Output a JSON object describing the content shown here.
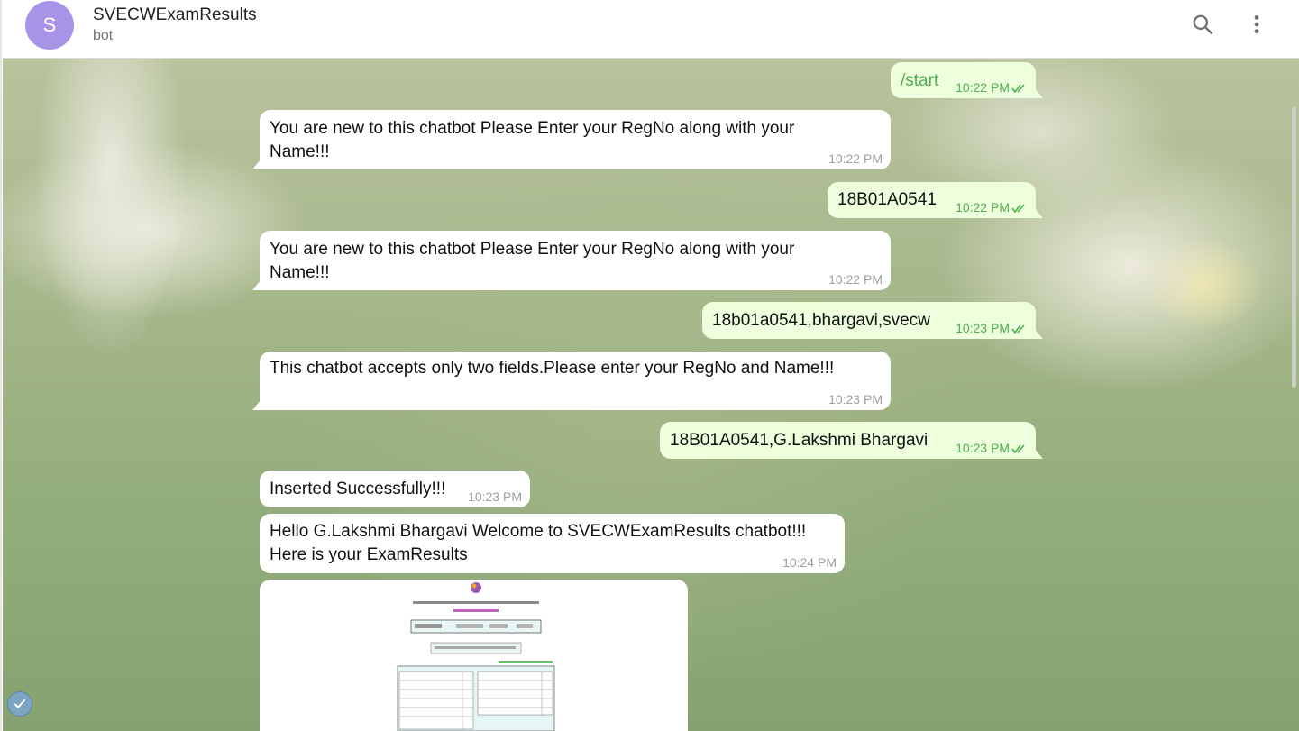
{
  "header": {
    "avatar_letter": "S",
    "title": "SVECWExamResults",
    "subtitle": "bot",
    "avatar_color": "#a695e7"
  },
  "messages": [
    {
      "from": "user",
      "text": "/start",
      "time": "10:22 PM"
    },
    {
      "from": "bot",
      "text": "You are new to this chatbot Please Enter your RegNo along with your Name!!!",
      "time": "10:22 PM"
    },
    {
      "from": "user",
      "text": "18B01A0541",
      "time": "10:22 PM"
    },
    {
      "from": "bot",
      "text": "You are new to this chatbot Please Enter your RegNo along with your Name!!!",
      "time": "10:22 PM"
    },
    {
      "from": "user",
      "text": "18b01a0541,bhargavi,svecw",
      "time": "10:23 PM"
    },
    {
      "from": "bot",
      "text": "This chatbot accepts only two fields.Please enter your RegNo and Name!!!",
      "time": "10:23 PM"
    },
    {
      "from": "user",
      "text": "18B01A0541,G.Lakshmi Bhargavi",
      "time": "10:23 PM"
    },
    {
      "from": "bot",
      "text": "Inserted Successfully!!!",
      "time": "10:23 PM"
    },
    {
      "from": "bot",
      "text": "Hello G.Lakshmi Bhargavi Welcome to SVECWExamResults chatbot!!! Here is your ExamResults",
      "time": "10:24 PM"
    }
  ],
  "colors": {
    "outgoing_bubble": "#eeffde",
    "incoming_bubble": "#ffffff",
    "outgoing_time": "#4fae4e",
    "incoming_time": "#9aa0a6"
  }
}
